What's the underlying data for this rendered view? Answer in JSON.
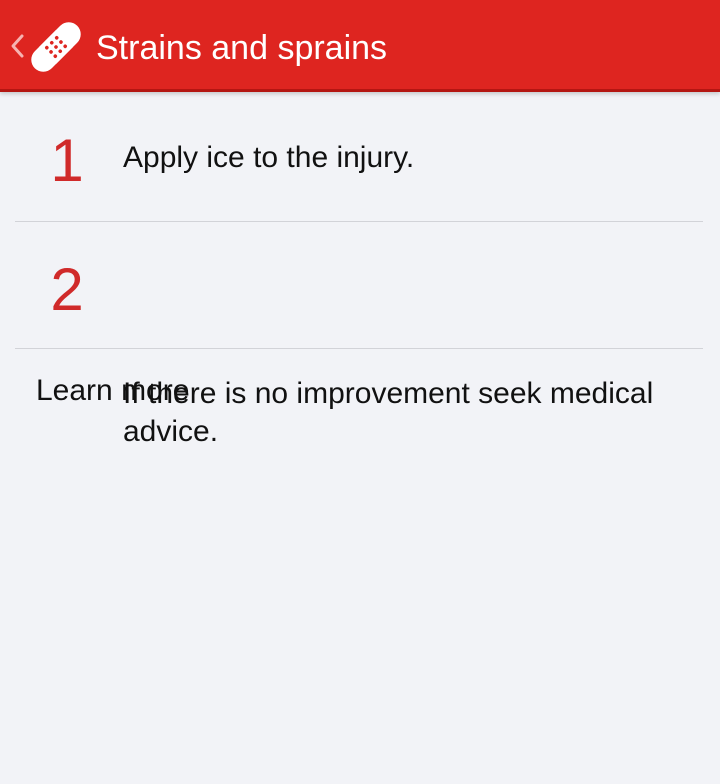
{
  "app_bar": {
    "title": "Strains and sprains",
    "icons": [
      "chevron-left-icon",
      "bandage-icon"
    ],
    "background": "#de2520"
  },
  "steps": [
    {
      "number": "1",
      "text": "Apply ice to the injury."
    },
    {
      "number": "2",
      "text": "If there is no improvement seek medical advice."
    }
  ],
  "learn_more": "Learn more",
  "colors": {
    "accent": "#d02a2a",
    "background": "#f2f3f7"
  }
}
